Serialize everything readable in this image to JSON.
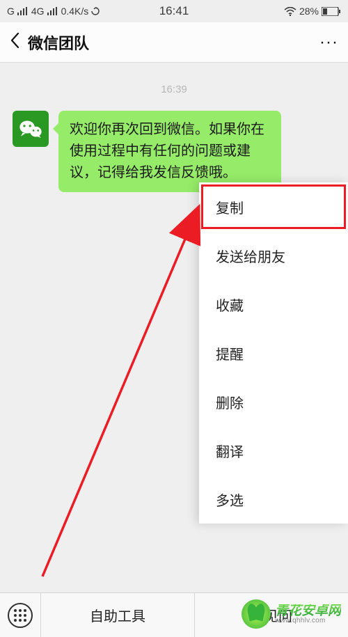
{
  "statusbar": {
    "net_type": "G",
    "net_gen": "4G",
    "speed": "0.4K/s",
    "time": "16:41",
    "battery_pct": "28%"
  },
  "header": {
    "title": "微信团队",
    "more": "···"
  },
  "chat": {
    "timestamp": "16:39",
    "message": "欢迎你再次回到微信。如果你在使用过程中有任何的问题或建议，记得给我发信反馈哦。"
  },
  "context_menu": {
    "items": [
      "复制",
      "发送给朋友",
      "收藏",
      "提醒",
      "删除",
      "翻译",
      "多选"
    ],
    "highlight_index": 0
  },
  "bottombar": {
    "items": [
      "自助工具",
      "常见问"
    ]
  },
  "watermark": {
    "cn": "青花安卓网",
    "en": "www.qhhlv.com"
  }
}
